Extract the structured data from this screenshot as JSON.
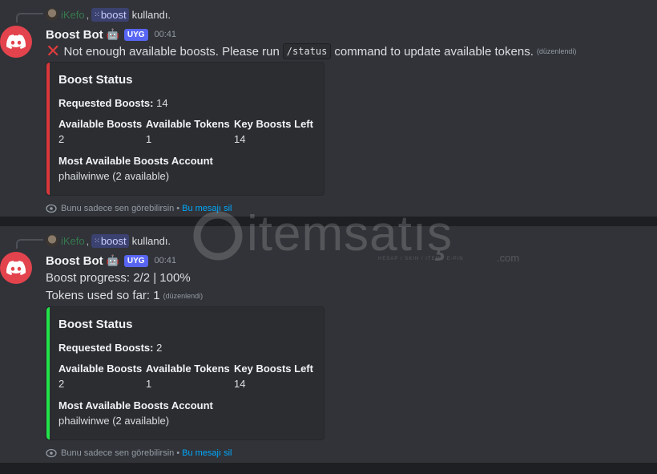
{
  "messages": [
    {
      "reply": {
        "user": "iKefo",
        "separator": ",",
        "command": "boost",
        "action": "kullandı."
      },
      "bot_name": "Boost Bot",
      "app_tag": "UYG",
      "time": "00:41",
      "line1": {
        "text_before": "Not enough available boosts. Please run",
        "code": "/status",
        "text_after": "command to update available tokens.",
        "edited": "(düzenlendi)"
      },
      "embed": {
        "color": "#da373c",
        "title": "Boost Status",
        "requested_label": "Requested Boosts:",
        "requested_value": "14",
        "fields": [
          {
            "name": "Available Boosts",
            "value": "2"
          },
          {
            "name": "Available Tokens",
            "value": "1"
          },
          {
            "name": "Key Boosts Left",
            "value": "14"
          }
        ],
        "most_name": "Most Available Boosts Account",
        "most_value": "phailwinwe (2 available)"
      },
      "ephemeral": {
        "text": "Bunu sadece sen görebilirsin",
        "separator": "•",
        "link": "Bu mesajı sil"
      }
    },
    {
      "reply": {
        "user": "iKefo",
        "separator": ",",
        "command": "boost",
        "action": "kullandı."
      },
      "bot_name": "Boost Bot",
      "app_tag": "UYG",
      "time": "00:41",
      "line1": {
        "text": "Boost progress: 2/2 | 100%"
      },
      "line2": {
        "text": "Tokens used so far: 1",
        "edited": "(düzenlendi)"
      },
      "embed": {
        "color": "#23e34a",
        "title": "Boost Status",
        "requested_label": "Requested Boosts:",
        "requested_value": "2",
        "fields": [
          {
            "name": "Available Boosts",
            "value": "2"
          },
          {
            "name": "Available Tokens",
            "value": "1"
          },
          {
            "name": "Key Boosts Left",
            "value": "14"
          }
        ],
        "most_name": "Most Available Boosts Account",
        "most_value": "phailwinwe (2 available)"
      },
      "ephemeral": {
        "text": "Bunu sadece sen görebilirsin",
        "separator": "•",
        "link": "Bu mesajı sil"
      }
    }
  ],
  "watermark": {
    "brand": "itemsatış",
    "tagline": "HESAP / SKIN / ITEM / E-PIN",
    "suffix": ".com"
  },
  "icons": {
    "avatar": "discord-logo-icon",
    "error": "cross-mark-icon",
    "ephemeral": "eye-icon",
    "command": "app-grid-icon",
    "bot_emoji": "robot-emoji-icon"
  }
}
